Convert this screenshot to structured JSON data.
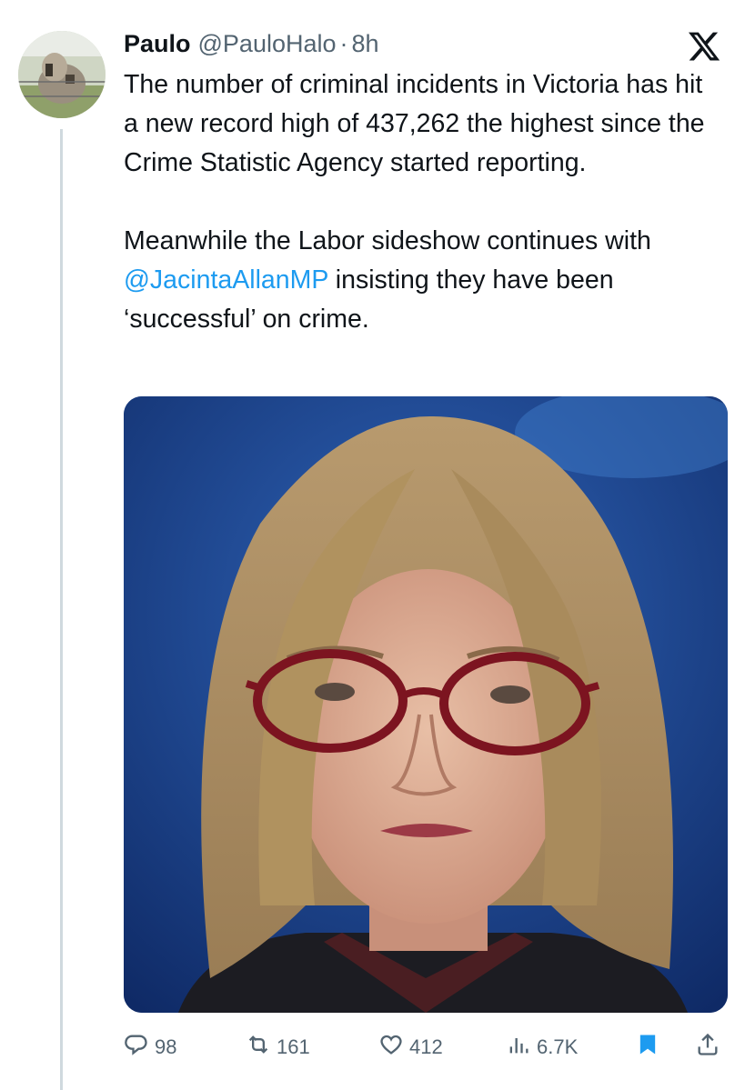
{
  "tweet": {
    "author_name": "Paulo",
    "author_handle": "@PauloHalo",
    "separator": "·",
    "time": "8h",
    "text_line1": "The number of criminal incidents in Victoria has hit a new record high of 437,262 the highest since the Crime Statistic Agency started reporting.",
    "text_line2_prefix": "Meanwhile the Labor sideshow continues with ",
    "mention": "@JacintaAllanMP",
    "text_line2_suffix": " insisting they have been ‘successful’ on crime."
  },
  "actions": {
    "replies": "98",
    "reposts": "161",
    "likes": "412",
    "views": "6.7K"
  },
  "icons": {
    "platform": "x-logo-icon",
    "reply": "reply-icon",
    "repost": "repost-icon",
    "like": "heart-icon",
    "views": "views-icon",
    "bookmark": "bookmark-icon",
    "share": "share-icon"
  },
  "colors": {
    "text": "#0f1419",
    "secondary": "#536471",
    "link": "#1d9bf0",
    "bookmark_active": "#1d9bf0",
    "thread_line": "#cfd9de"
  }
}
